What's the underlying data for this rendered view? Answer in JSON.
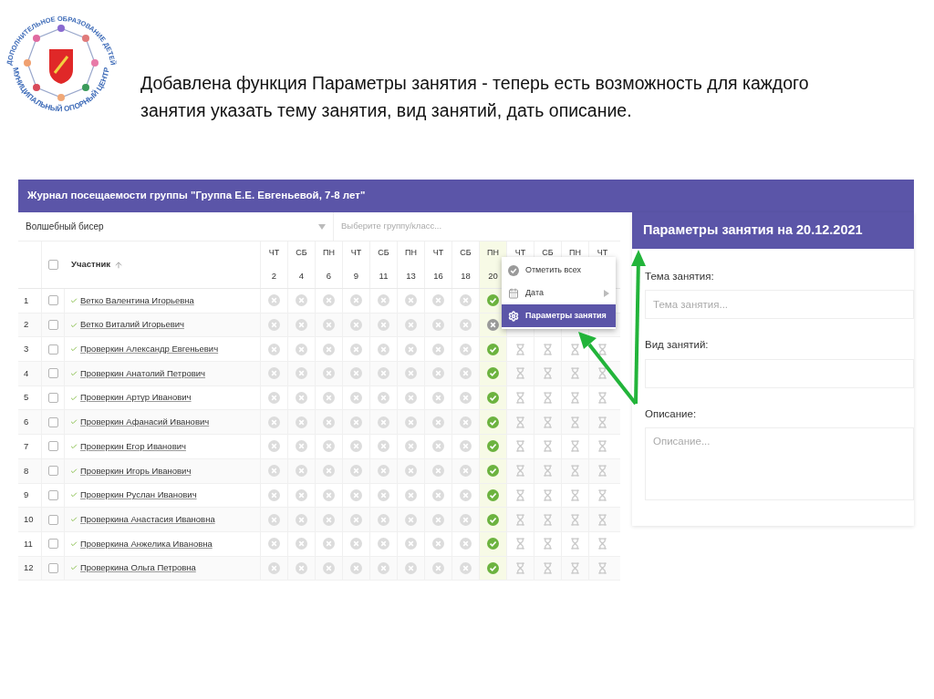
{
  "logo": {
    "top_text": "ДОПОЛНИТЕЛЬНОЕ ОБРАЗОВАНИЕ ДЕТЕЙ",
    "bottom_text": "МУНИЦИПАЛЬНЫЙ ОПОРНЫЙ ЦЕНТР"
  },
  "slide_text": "Добавлена функция Параметры занятия - теперь есть возможность для каждого занятия указать тему занятия, вид занятий, дать описание.",
  "journal": {
    "title": "Журнал посещаемости группы \"Группа Е.Е. Евгеньевой, 7-8 лет\"",
    "course_select": {
      "value": "Волшебный бисер"
    },
    "group_field": {
      "placeholder": "Выберите группу/класс..."
    },
    "participant_header": {
      "label": "Участник",
      "checked": false
    },
    "days": [
      {
        "day": "ЧТ",
        "date": "2",
        "highlighted": false
      },
      {
        "day": "СБ",
        "date": "4",
        "highlighted": false
      },
      {
        "day": "ПН",
        "date": "6",
        "highlighted": false
      },
      {
        "day": "ЧТ",
        "date": "9",
        "highlighted": false
      },
      {
        "day": "СБ",
        "date": "11",
        "highlighted": false
      },
      {
        "day": "ПН",
        "date": "13",
        "highlighted": false
      },
      {
        "day": "ЧТ",
        "date": "16",
        "highlighted": false
      },
      {
        "day": "СБ",
        "date": "18",
        "highlighted": false
      },
      {
        "day": "ПН",
        "date": "20",
        "highlighted": true
      },
      {
        "day": "ЧТ",
        "highlighted": false
      },
      {
        "day": "СБ",
        "highlighted": false
      },
      {
        "day": "ПН",
        "highlighted": false
      },
      {
        "day": "ЧТ",
        "highlighted": false
      }
    ],
    "rows": [
      {
        "number": "1",
        "checked": false,
        "name": "Ветко Валентина Игорьевна",
        "marks": [
          {
            "kind": "none"
          },
          {
            "kind": "none"
          },
          {
            "kind": "none"
          },
          {
            "kind": "none"
          },
          {
            "kind": "none"
          },
          {
            "kind": "none"
          },
          {
            "kind": "none"
          },
          {
            "kind": "none"
          },
          {
            "kind": "present"
          }
        ]
      },
      {
        "number": "2",
        "checked": false,
        "name": "Ветко Виталий Игорьевич",
        "marks": [
          {
            "kind": "none"
          },
          {
            "kind": "none"
          },
          {
            "kind": "none"
          },
          {
            "kind": "none"
          },
          {
            "kind": "none"
          },
          {
            "kind": "none"
          },
          {
            "kind": "none"
          },
          {
            "kind": "none"
          },
          {
            "kind": "absent"
          }
        ]
      },
      {
        "number": "3",
        "checked": false,
        "name": "Проверкин Александр Евгеньевич",
        "marks": [
          {
            "kind": "none"
          },
          {
            "kind": "none"
          },
          {
            "kind": "none"
          },
          {
            "kind": "none"
          },
          {
            "kind": "none"
          },
          {
            "kind": "none"
          },
          {
            "kind": "none"
          },
          {
            "kind": "none"
          },
          {
            "kind": "present"
          },
          {
            "kind": "pending"
          },
          {
            "kind": "pending"
          },
          {
            "kind": "pending"
          },
          {
            "kind": "pending"
          }
        ]
      },
      {
        "number": "4",
        "checked": false,
        "name": "Проверкин Анатолий Петрович",
        "marks": [
          {
            "kind": "none"
          },
          {
            "kind": "none"
          },
          {
            "kind": "none"
          },
          {
            "kind": "none"
          },
          {
            "kind": "none"
          },
          {
            "kind": "none"
          },
          {
            "kind": "none"
          },
          {
            "kind": "none"
          },
          {
            "kind": "present"
          },
          {
            "kind": "pending"
          },
          {
            "kind": "pending"
          },
          {
            "kind": "pending"
          },
          {
            "kind": "pending"
          }
        ]
      },
      {
        "number": "5",
        "checked": false,
        "name": "Проверкин Артур Иванович",
        "marks": [
          {
            "kind": "none"
          },
          {
            "kind": "none"
          },
          {
            "kind": "none"
          },
          {
            "kind": "none"
          },
          {
            "kind": "none"
          },
          {
            "kind": "none"
          },
          {
            "kind": "none"
          },
          {
            "kind": "none"
          },
          {
            "kind": "present"
          },
          {
            "kind": "pending"
          },
          {
            "kind": "pending"
          },
          {
            "kind": "pending"
          },
          {
            "kind": "pending"
          }
        ]
      },
      {
        "number": "6",
        "checked": false,
        "name": "Проверкин Афанасий Иванович",
        "marks": [
          {
            "kind": "none"
          },
          {
            "kind": "none"
          },
          {
            "kind": "none"
          },
          {
            "kind": "none"
          },
          {
            "kind": "none"
          },
          {
            "kind": "none"
          },
          {
            "kind": "none"
          },
          {
            "kind": "none"
          },
          {
            "kind": "present"
          },
          {
            "kind": "pending"
          },
          {
            "kind": "pending"
          },
          {
            "kind": "pending"
          },
          {
            "kind": "pending"
          }
        ]
      },
      {
        "number": "7",
        "checked": false,
        "name": "Проверкин Егор Иванович",
        "marks": [
          {
            "kind": "none"
          },
          {
            "kind": "none"
          },
          {
            "kind": "none"
          },
          {
            "kind": "none"
          },
          {
            "kind": "none"
          },
          {
            "kind": "none"
          },
          {
            "kind": "none"
          },
          {
            "kind": "none"
          },
          {
            "kind": "present"
          },
          {
            "kind": "pending"
          },
          {
            "kind": "pending"
          },
          {
            "kind": "pending"
          },
          {
            "kind": "pending"
          }
        ]
      },
      {
        "number": "8",
        "checked": false,
        "name": "Проверкин Игорь Иванович",
        "marks": [
          {
            "kind": "none"
          },
          {
            "kind": "none"
          },
          {
            "kind": "none"
          },
          {
            "kind": "none"
          },
          {
            "kind": "none"
          },
          {
            "kind": "none"
          },
          {
            "kind": "none"
          },
          {
            "kind": "none"
          },
          {
            "kind": "present"
          },
          {
            "kind": "pending"
          },
          {
            "kind": "pending"
          },
          {
            "kind": "pending"
          },
          {
            "kind": "pending"
          }
        ]
      },
      {
        "number": "9",
        "checked": false,
        "name": "Проверкин Руслан Иванович",
        "marks": [
          {
            "kind": "none"
          },
          {
            "kind": "none"
          },
          {
            "kind": "none"
          },
          {
            "kind": "none"
          },
          {
            "kind": "none"
          },
          {
            "kind": "none"
          },
          {
            "kind": "none"
          },
          {
            "kind": "none"
          },
          {
            "kind": "present"
          },
          {
            "kind": "pending"
          },
          {
            "kind": "pending"
          },
          {
            "kind": "pending"
          },
          {
            "kind": "pending"
          }
        ]
      },
      {
        "number": "10",
        "checked": false,
        "name": "Проверкина Анастасия Ивановна",
        "marks": [
          {
            "kind": "none"
          },
          {
            "kind": "none"
          },
          {
            "kind": "none"
          },
          {
            "kind": "none"
          },
          {
            "kind": "none"
          },
          {
            "kind": "none"
          },
          {
            "kind": "none"
          },
          {
            "kind": "none"
          },
          {
            "kind": "present"
          },
          {
            "kind": "pending"
          },
          {
            "kind": "pending"
          },
          {
            "kind": "pending"
          },
          {
            "kind": "pending"
          }
        ]
      },
      {
        "number": "11",
        "checked": false,
        "name": "Проверкина Анжелика Ивановна",
        "marks": [
          {
            "kind": "none"
          },
          {
            "kind": "none"
          },
          {
            "kind": "none"
          },
          {
            "kind": "none"
          },
          {
            "kind": "none"
          },
          {
            "kind": "none"
          },
          {
            "kind": "none"
          },
          {
            "kind": "none"
          },
          {
            "kind": "present"
          },
          {
            "kind": "pending"
          },
          {
            "kind": "pending"
          },
          {
            "kind": "pending"
          },
          {
            "kind": "pending"
          }
        ]
      },
      {
        "number": "12",
        "checked": false,
        "name": "Проверкина Ольга Петровна",
        "marks": [
          {
            "kind": "none"
          },
          {
            "kind": "none"
          },
          {
            "kind": "none"
          },
          {
            "kind": "none"
          },
          {
            "kind": "none"
          },
          {
            "kind": "none"
          },
          {
            "kind": "none"
          },
          {
            "kind": "none"
          },
          {
            "kind": "present"
          },
          {
            "kind": "pending"
          },
          {
            "kind": "pending"
          },
          {
            "kind": "pending"
          },
          {
            "kind": "pending"
          }
        ]
      }
    ]
  },
  "context_menu": [
    {
      "kind": "mark_all",
      "label": "Отметить всех",
      "selected": false
    },
    {
      "kind": "date",
      "label": "Дата",
      "selected": false
    },
    {
      "kind": "params",
      "label": "Параметры занятия",
      "selected": true
    }
  ],
  "params_panel": {
    "title": "Параметры занятия на 20.12.2021",
    "fields": [
      {
        "kind": "input",
        "label": "Тема занятия:",
        "placeholder": "Тема занятия..."
      },
      {
        "kind": "input",
        "label": "Вид занятий:"
      },
      {
        "kind": "textarea",
        "label": "Описание:",
        "placeholder": "Описание..."
      }
    ]
  }
}
